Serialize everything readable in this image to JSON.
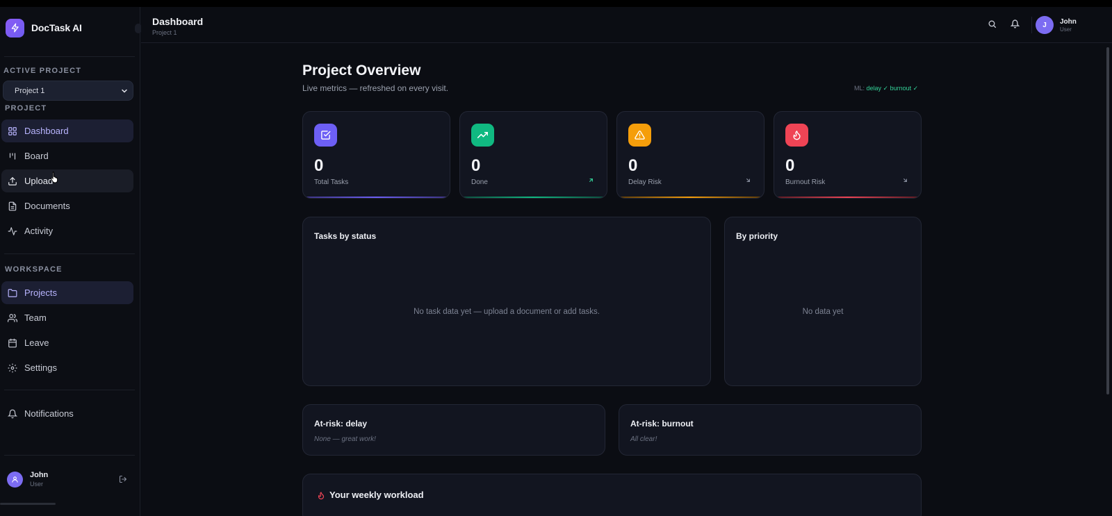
{
  "sidebar": {
    "brand": "DocTask AI",
    "active_project_label": "ACTIVE PROJECT",
    "project_select_value": "Project 1",
    "project_section_label": "PROJECT",
    "project_items": [
      {
        "label": "Dashboard",
        "icon": "grid-icon",
        "state": "active"
      },
      {
        "label": "Board",
        "icon": "columns-icon",
        "state": "normal"
      },
      {
        "label": "Upload",
        "icon": "upload-icon",
        "state": "hover"
      },
      {
        "label": "Documents",
        "icon": "file-icon",
        "state": "normal"
      },
      {
        "label": "Activity",
        "icon": "activity-icon",
        "state": "normal"
      }
    ],
    "workspace_section_label": "WORKSPACE",
    "workspace_items": [
      {
        "label": "Projects",
        "icon": "folder-icon",
        "state": "active"
      },
      {
        "label": "Team",
        "icon": "users-icon",
        "state": "normal"
      },
      {
        "label": "Leave",
        "icon": "calendar-icon",
        "state": "normal"
      },
      {
        "label": "Settings",
        "icon": "gear-icon",
        "state": "normal"
      }
    ],
    "notifications_label": "Notifications",
    "user": {
      "name": "John",
      "role": "User"
    }
  },
  "header": {
    "title": "Dashboard",
    "subtitle": "Project 1",
    "user": {
      "initial": "J",
      "name": "John",
      "role": "User"
    }
  },
  "main": {
    "title": "Project Overview",
    "subtitle": "Live metrics — refreshed on every visit.",
    "ml_status": {
      "prefix": "ML:",
      "delay": "delay ✓",
      "burnout": "burnout ✓"
    },
    "stats": [
      {
        "value": "0",
        "label": "Total Tasks",
        "icon": "check-square-icon",
        "color": "#6d5ff5"
      },
      {
        "value": "0",
        "label": "Done",
        "icon": "trending-up-icon",
        "color": "#10b981"
      },
      {
        "value": "0",
        "label": "Delay Risk",
        "icon": "warning-icon",
        "color": "#f59e0b"
      },
      {
        "value": "0",
        "label": "Burnout Risk",
        "icon": "flame-icon",
        "color": "#ef4455"
      }
    ],
    "tasks_by_status": {
      "title": "Tasks by status",
      "empty": "No task data yet — upload a document or add tasks."
    },
    "by_priority": {
      "title": "By priority",
      "empty": "No data yet"
    },
    "at_risk_delay": {
      "title": "At-risk: delay",
      "note": "None — great work!"
    },
    "at_risk_burnout": {
      "title": "At-risk: burnout",
      "note": "All clear!"
    },
    "weekly_workload": {
      "title": "Your weekly workload"
    }
  },
  "colors": {
    "accent": "#7c6cf2",
    "background": "#0b0d13",
    "card": "#121520"
  }
}
